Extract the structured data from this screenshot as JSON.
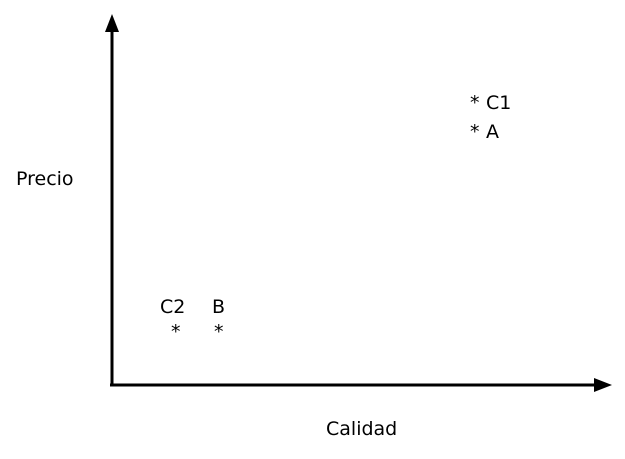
{
  "axes": {
    "y_label": "Precio",
    "x_label": "Calidad",
    "color": "#000000"
  },
  "markers": [
    {
      "marker": "*",
      "label": "C1"
    },
    {
      "marker": "*",
      "label": "A"
    },
    {
      "marker": "*",
      "label": "C2"
    },
    {
      "marker": "*",
      "label": "B"
    }
  ]
}
